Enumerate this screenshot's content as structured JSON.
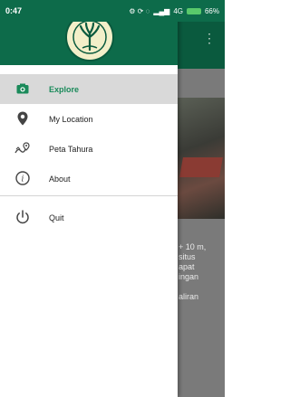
{
  "status_bar": {
    "time": "0:47",
    "network": "4G",
    "battery": "66%"
  },
  "drawer": {
    "menu": [
      {
        "label": "Explore",
        "icon": "camera-icon",
        "active": true
      },
      {
        "label": "My Location",
        "icon": "location-pin-icon",
        "active": false
      },
      {
        "label": "Peta Tahura",
        "icon": "map-icon",
        "active": false
      },
      {
        "label": "About",
        "icon": "info-icon",
        "active": false
      }
    ],
    "quit": {
      "label": "Quit",
      "icon": "power-icon"
    }
  },
  "background": {
    "text_lines": [
      "+ 10 m,",
      "situs",
      "apat",
      "ingan",
      "aliran"
    ]
  },
  "colors": {
    "primary": "#0d6b4a",
    "active_item": "#1a8a5a"
  }
}
